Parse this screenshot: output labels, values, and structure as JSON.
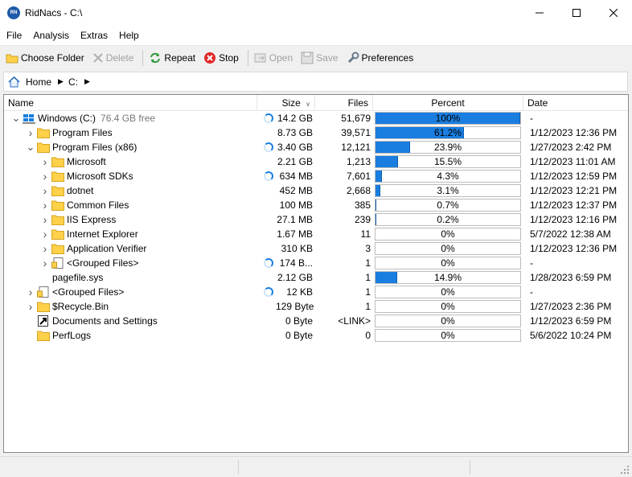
{
  "window": {
    "title": "RidNacs - C:\\",
    "app_icon_text": "RN",
    "buttons": {
      "minimize": "minimize-icon",
      "maximize": "maximize-icon",
      "close": "close-icon"
    }
  },
  "menu": {
    "items": [
      {
        "label": "File",
        "name": "menu-file"
      },
      {
        "label": "Analysis",
        "name": "menu-analysis"
      },
      {
        "label": "Extras",
        "name": "menu-extras"
      },
      {
        "label": "Help",
        "name": "menu-help"
      }
    ]
  },
  "toolbar": {
    "choose_folder": "Choose Folder",
    "delete": "Delete",
    "repeat": "Repeat",
    "stop": "Stop",
    "open": "Open",
    "save": "Save",
    "preferences": "Preferences"
  },
  "address": {
    "home": "Home",
    "drive": "C:"
  },
  "columns": {
    "name": "Name",
    "size": "Size",
    "files": "Files",
    "percent": "Percent",
    "date": "Date"
  },
  "colors": {
    "bar_fill": "#1a7ee0",
    "folder": "#ffd04a",
    "spinner": "#1a7ee0"
  },
  "rows": [
    {
      "name": "Windows (C:)",
      "free": "76.4 GB free",
      "level": 0,
      "expander": "down",
      "icon": "drive-icon",
      "spinner": true,
      "size": "14.2 GB",
      "files": "51,679",
      "percent_label": "100%",
      "percent": 1.0,
      "date": "-"
    },
    {
      "name": "Program Files",
      "free": "",
      "level": 1,
      "expander": "right",
      "icon": "folder-icon",
      "spinner": false,
      "size": "8.73 GB",
      "files": "39,571",
      "percent_label": "61.2%",
      "percent": 0.612,
      "date": "1/12/2023 12:36 PM"
    },
    {
      "name": "Program Files (x86)",
      "free": "",
      "level": 1,
      "expander": "down",
      "icon": "folder-icon",
      "spinner": true,
      "size": "3.40 GB",
      "files": "12,121",
      "percent_label": "23.9%",
      "percent": 0.239,
      "date": "1/27/2023 2:42 PM"
    },
    {
      "name": "Microsoft",
      "free": "",
      "level": 2,
      "expander": "right",
      "icon": "folder-icon",
      "spinner": false,
      "size": "2.21 GB",
      "files": "1,213",
      "percent_label": "15.5%",
      "percent": 0.155,
      "date": "1/12/2023 11:01 AM"
    },
    {
      "name": "Microsoft SDKs",
      "free": "",
      "level": 2,
      "expander": "right",
      "icon": "folder-icon",
      "spinner": true,
      "size": "634 MB",
      "files": "7,601",
      "percent_label": "4.3%",
      "percent": 0.043,
      "date": "1/12/2023 12:59 PM"
    },
    {
      "name": "dotnet",
      "free": "",
      "level": 2,
      "expander": "right",
      "icon": "folder-icon",
      "spinner": false,
      "size": "452 MB",
      "files": "2,668",
      "percent_label": "3.1%",
      "percent": 0.031,
      "date": "1/12/2023 12:21 PM"
    },
    {
      "name": "Common Files",
      "free": "",
      "level": 2,
      "expander": "right",
      "icon": "folder-icon",
      "spinner": false,
      "size": "100 MB",
      "files": "385",
      "percent_label": "0.7%",
      "percent": 0.007,
      "date": "1/12/2023 12:37 PM"
    },
    {
      "name": "IIS Express",
      "free": "",
      "level": 2,
      "expander": "right",
      "icon": "folder-icon",
      "spinner": false,
      "size": "27.1 MB",
      "files": "239",
      "percent_label": "0.2%",
      "percent": 0.002,
      "date": "1/12/2023 12:16 PM"
    },
    {
      "name": "Internet Explorer",
      "free": "",
      "level": 2,
      "expander": "right",
      "icon": "folder-icon",
      "spinner": false,
      "size": "1.67 MB",
      "files": "11",
      "percent_label": "0%",
      "percent": 0.0,
      "date": "5/7/2022 12:38 AM"
    },
    {
      "name": "Application Verifier",
      "free": "",
      "level": 2,
      "expander": "right",
      "icon": "folder-icon",
      "spinner": false,
      "size": "310 KB",
      "files": "3",
      "percent_label": "0%",
      "percent": 0.0,
      "date": "1/12/2023 12:36 PM"
    },
    {
      "name": "<Grouped Files>",
      "free": "",
      "level": 2,
      "expander": "right",
      "icon": "grouped-files-icon",
      "spinner": true,
      "size": "174 B...",
      "files": "1",
      "percent_label": "0%",
      "percent": 0.0,
      "date": "-"
    },
    {
      "name": "pagefile.sys",
      "free": "",
      "level": 1,
      "expander": "none",
      "icon": "none",
      "spinner": false,
      "size": "2.12 GB",
      "files": "1",
      "percent_label": "14.9%",
      "percent": 0.149,
      "date": "1/28/2023 6:59 PM"
    },
    {
      "name": "<Grouped Files>",
      "free": "",
      "level": 1,
      "expander": "right",
      "icon": "grouped-files-icon",
      "spinner": true,
      "size": "12 KB",
      "files": "1",
      "percent_label": "0%",
      "percent": 0.0,
      "date": "-"
    },
    {
      "name": "$Recycle.Bin",
      "free": "",
      "level": 1,
      "expander": "right",
      "icon": "folder-icon",
      "spinner": false,
      "size": "129 Byte",
      "files": "1",
      "percent_label": "0%",
      "percent": 0.0,
      "date": "1/27/2023 2:36 PM"
    },
    {
      "name": "Documents and Settings",
      "free": "",
      "level": 1,
      "expander": "none",
      "icon": "link-icon",
      "spinner": false,
      "size": "0 Byte",
      "files": "<LINK>",
      "percent_label": "0%",
      "percent": 0.0,
      "date": "1/12/2023 6:59 PM"
    },
    {
      "name": "PerfLogs",
      "free": "",
      "level": 1,
      "expander": "none",
      "icon": "folder-icon",
      "spinner": false,
      "size": "0 Byte",
      "files": "0",
      "percent_label": "0%",
      "percent": 0.0,
      "date": "5/6/2022 10:24 PM"
    }
  ]
}
